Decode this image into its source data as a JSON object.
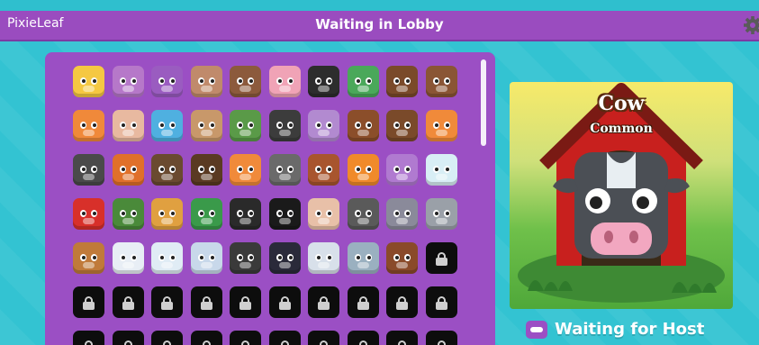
{
  "header": {
    "brand": "PixieLeaf",
    "title": "Waiting in Lobby"
  },
  "blook_grid": {
    "rows": [
      [
        {
          "color": "#f5c842",
          "locked": false
        },
        {
          "color": "#b678c9",
          "locked": false
        },
        {
          "color": "#9a5cc0",
          "locked": false
        },
        {
          "color": "#c08a6b",
          "locked": false
        },
        {
          "color": "#8c5a3c",
          "locked": false
        },
        {
          "color": "#f0a3b6",
          "locked": false
        },
        {
          "color": "#2d2d2d",
          "locked": false
        },
        {
          "color": "#4aa85a",
          "locked": false
        },
        {
          "color": "#7a4a2a",
          "locked": false
        },
        {
          "color": "#8a5535",
          "locked": false
        }
      ],
      [
        {
          "color": "#f0893a",
          "locked": false
        },
        {
          "color": "#e8b9a0",
          "locked": false
        },
        {
          "color": "#4fb0e0",
          "locked": false
        },
        {
          "color": "#c8986a",
          "locked": false
        },
        {
          "color": "#5a9a48",
          "locked": false
        },
        {
          "color": "#3c3c3c",
          "locked": false
        },
        {
          "color": "#b28ad0",
          "locked": false
        },
        {
          "color": "#8b4e2a",
          "locked": false
        },
        {
          "color": "#7a4a2a",
          "locked": false
        },
        {
          "color": "#f08a3a",
          "locked": false
        }
      ],
      [
        {
          "color": "#4a4a4a",
          "locked": false
        },
        {
          "color": "#e0702a",
          "locked": false
        },
        {
          "color": "#6a4a30",
          "locked": false
        },
        {
          "color": "#5a3a22",
          "locked": false
        },
        {
          "color": "#f08a3a",
          "locked": false
        },
        {
          "color": "#6a6a6a",
          "locked": false
        },
        {
          "color": "#a8552e",
          "locked": false
        },
        {
          "color": "#f08a2a",
          "locked": false
        },
        {
          "color": "#b07ad0",
          "locked": false
        },
        {
          "color": "#d8eef5",
          "locked": false
        }
      ],
      [
        {
          "color": "#d8302a",
          "locked": false
        },
        {
          "color": "#4a8a3a",
          "locked": false
        },
        {
          "color": "#e0a040",
          "locked": false
        },
        {
          "color": "#3a9a4a",
          "locked": false
        },
        {
          "color": "#2a2a2a",
          "locked": false
        },
        {
          "color": "#1a1a1a",
          "locked": false
        },
        {
          "color": "#e8c0a8",
          "locked": false
        },
        {
          "color": "#5a5a5a",
          "locked": false
        },
        {
          "color": "#8a8a9a",
          "locked": false
        },
        {
          "color": "#9aa0a8",
          "locked": false
        }
      ],
      [
        {
          "color": "#c07a3a",
          "locked": false
        },
        {
          "color": "#e8eef5",
          "locked": false
        },
        {
          "color": "#e0ecf5",
          "locked": false
        },
        {
          "color": "#c8d8ea",
          "locked": false
        },
        {
          "color": "#3a3a3a",
          "locked": false
        },
        {
          "color": "#2a2a3a",
          "locked": false
        },
        {
          "color": "#d8e0ea",
          "locked": false
        },
        {
          "color": "#9ab0c0",
          "locked": false
        },
        {
          "color": "#8a4a2a",
          "locked": false
        },
        {
          "color": "#0d0d0d",
          "locked": true
        }
      ],
      [
        {
          "color": "#0d0d0d",
          "locked": true
        },
        {
          "color": "#0d0d0d",
          "locked": true
        },
        {
          "color": "#0d0d0d",
          "locked": true
        },
        {
          "color": "#0d0d0d",
          "locked": true
        },
        {
          "color": "#0d0d0d",
          "locked": true
        },
        {
          "color": "#0d0d0d",
          "locked": true
        },
        {
          "color": "#0d0d0d",
          "locked": true
        },
        {
          "color": "#0d0d0d",
          "locked": true
        },
        {
          "color": "#0d0d0d",
          "locked": true
        },
        {
          "color": "#0d0d0d",
          "locked": true
        }
      ],
      [
        {
          "color": "#0d0d0d",
          "locked": true
        },
        {
          "color": "#0d0d0d",
          "locked": true
        },
        {
          "color": "#0d0d0d",
          "locked": true
        },
        {
          "color": "#0d0d0d",
          "locked": true
        },
        {
          "color": "#0d0d0d",
          "locked": true
        },
        {
          "color": "#0d0d0d",
          "locked": true
        },
        {
          "color": "#0d0d0d",
          "locked": true
        },
        {
          "color": "#0d0d0d",
          "locked": true
        },
        {
          "color": "#0d0d0d",
          "locked": true
        },
        {
          "color": "#0d0d0d",
          "locked": true
        }
      ]
    ]
  },
  "selected_blook": {
    "name": "Cow",
    "rarity": "Common"
  },
  "status": {
    "text": "Waiting for Host",
    "icon": "controller-icon"
  },
  "colors": {
    "topbar": "#9a4cbf",
    "panel": "#9b4fc4",
    "background": "#33c3d2"
  }
}
